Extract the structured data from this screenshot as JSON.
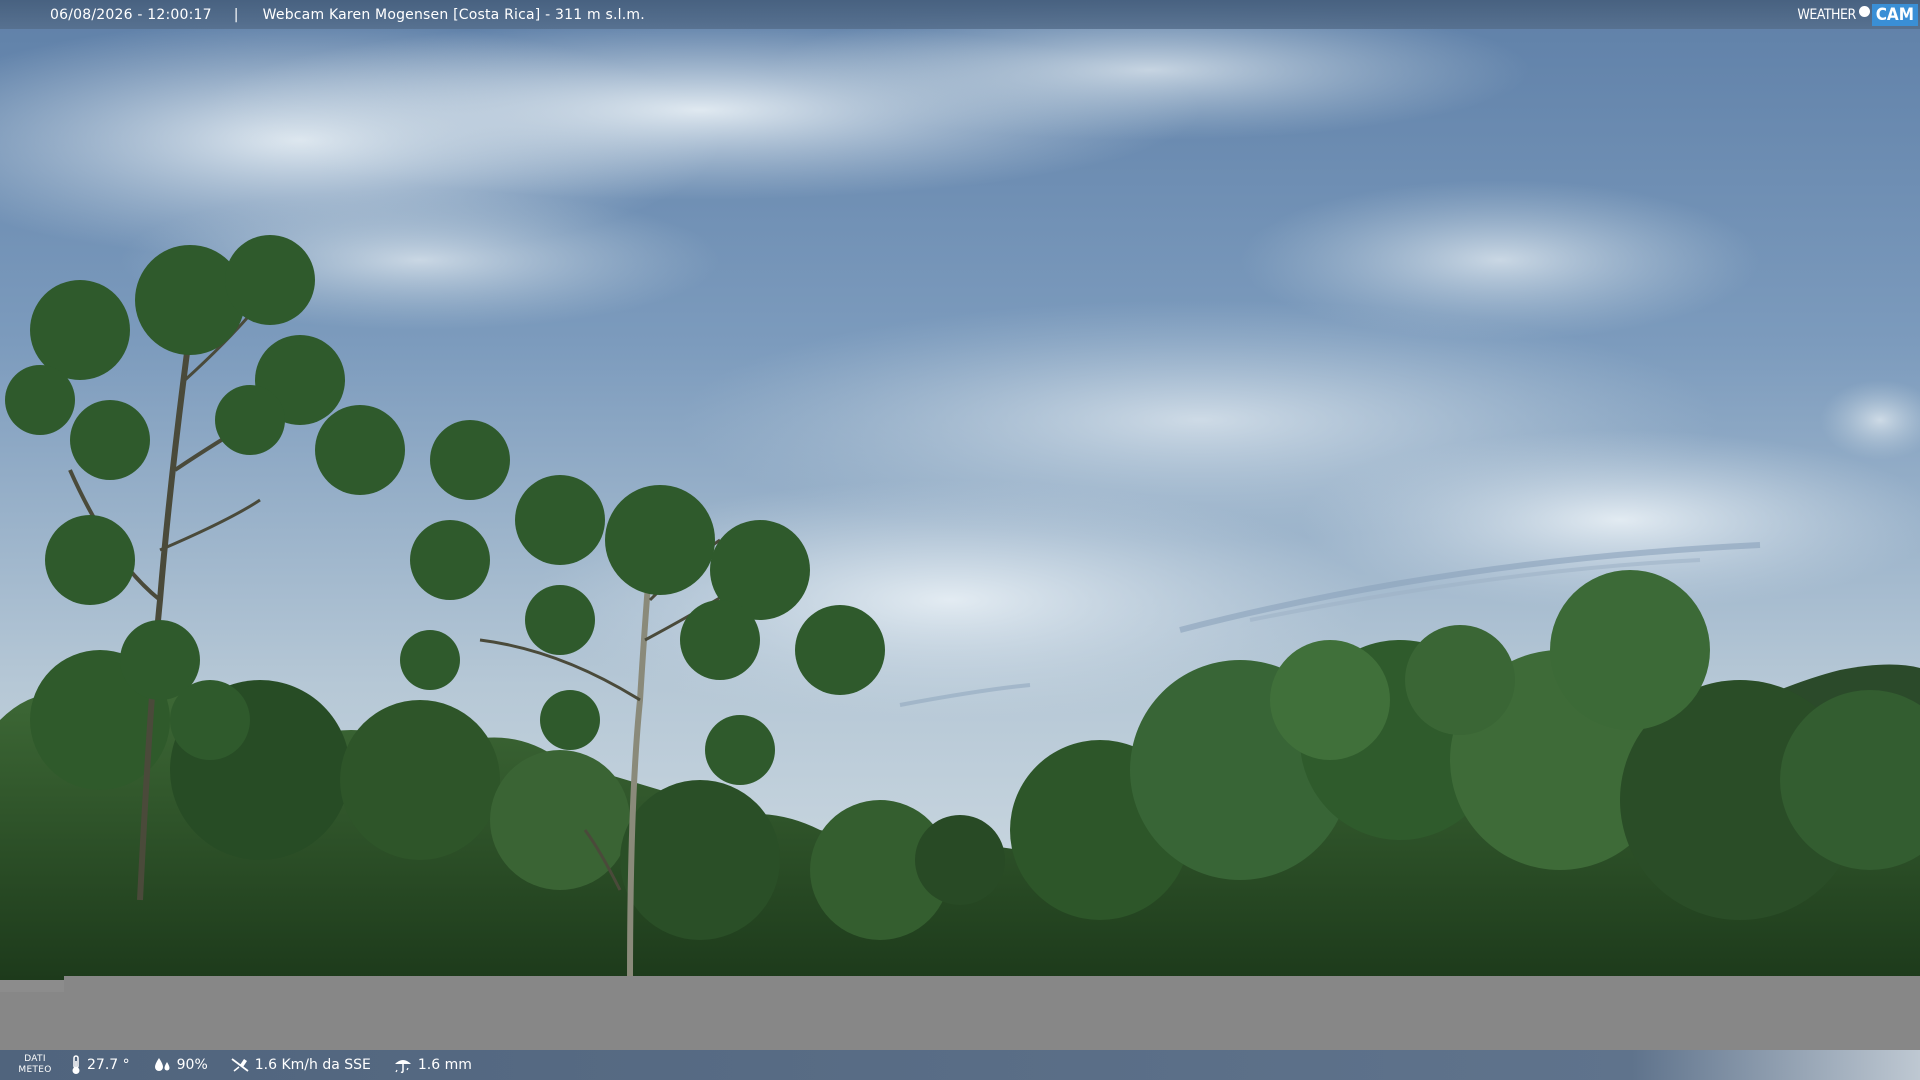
{
  "header": {
    "timestamp": "06/08/2026 - 12:00:17",
    "separator": "|",
    "title": "Webcam Karen Mogensen [Costa Rica] - 311 m s.l.m.",
    "brand_weather": "WEATHER",
    "brand_cam": "CAM"
  },
  "weather_bar": {
    "label_line1": "DATI",
    "label_line2": "METEO",
    "temperature": "27.7 °",
    "humidity": "90%",
    "wind": "1.6 Km/h da SSE",
    "rain": "1.6 mm",
    "icons": [
      "thermometer-icon",
      "humidity-icon",
      "wind-icon",
      "rain-icon"
    ]
  },
  "colors": {
    "sky_top": "#6f8fb4",
    "sky_horizon": "#c9d6df",
    "foliage_dark": "#1f3a1c",
    "foliage_mid": "#3d6632",
    "grey_band": "#878787",
    "brand_accent": "#3a8fd6"
  }
}
